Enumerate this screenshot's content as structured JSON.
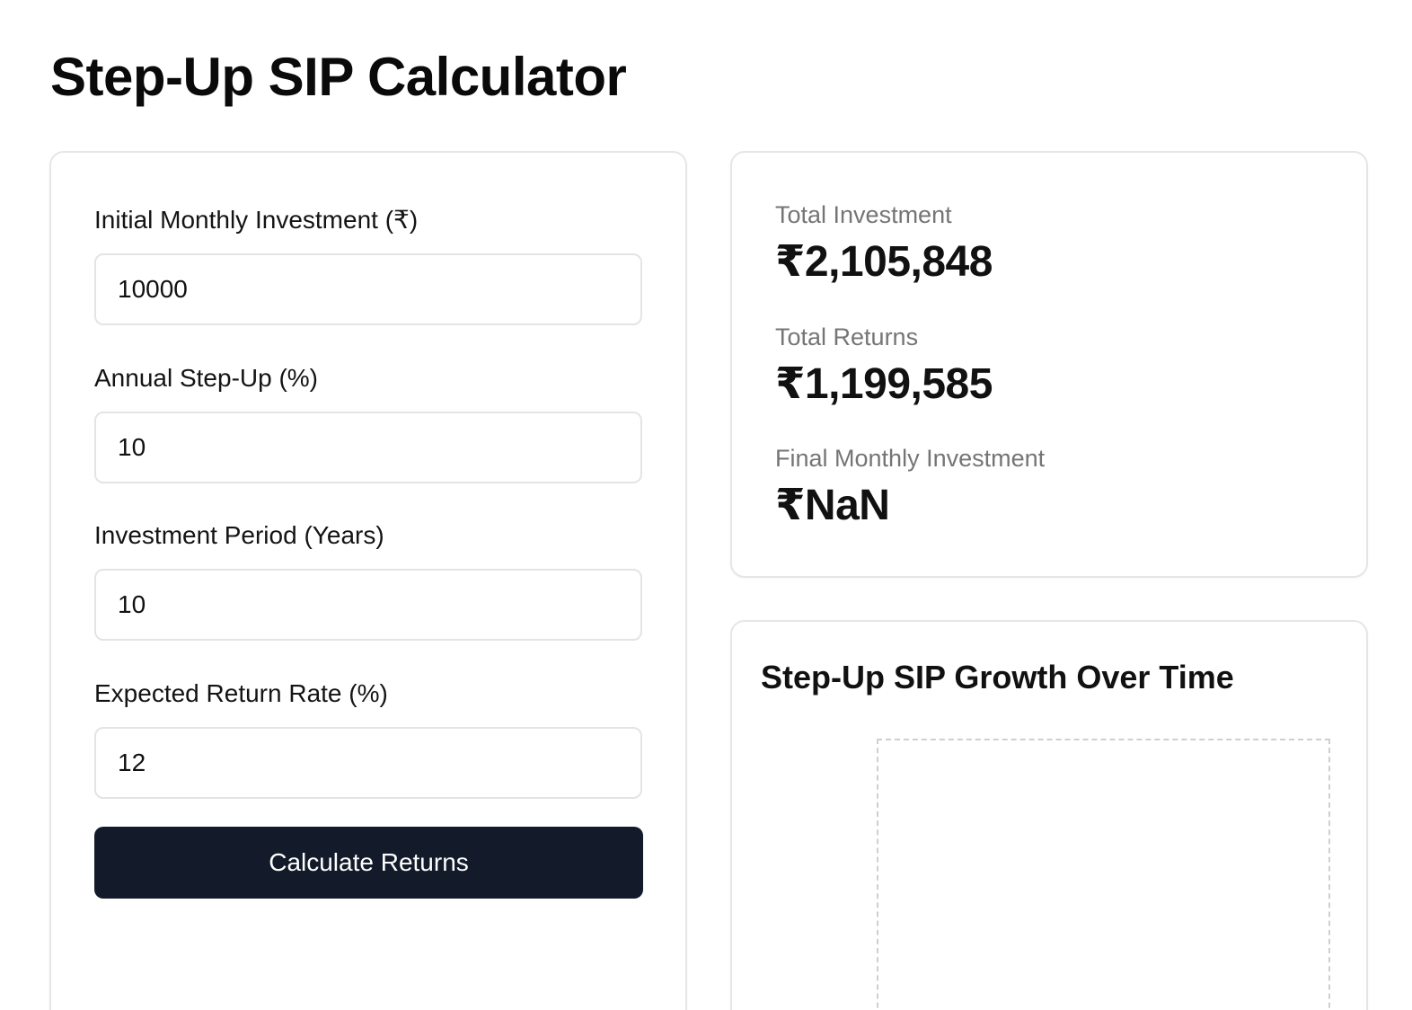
{
  "page": {
    "title": "Step-Up SIP Calculator"
  },
  "form": {
    "fields": [
      {
        "label": "Initial Monthly Investment (₹)",
        "value": "10000"
      },
      {
        "label": "Annual Step-Up (%)",
        "value": "10"
      },
      {
        "label": "Investment Period (Years)",
        "value": "10"
      },
      {
        "label": "Expected Return Rate (%)",
        "value": "12"
      }
    ],
    "button_label": "Calculate Returns"
  },
  "summary": {
    "total_investment_label": "Total Investment",
    "total_investment_value": "₹2,105,848",
    "total_returns_label": "Total Returns",
    "total_returns_value": "₹1,199,585",
    "final_monthly_label": "Final Monthly Investment",
    "final_monthly_value": "₹NaN"
  },
  "chart": {
    "title": "Step-Up SIP Growth Over Time"
  },
  "colors": {
    "button_bg": "#131a2a",
    "label_muted": "#757575",
    "border": "#e6e6e6"
  }
}
